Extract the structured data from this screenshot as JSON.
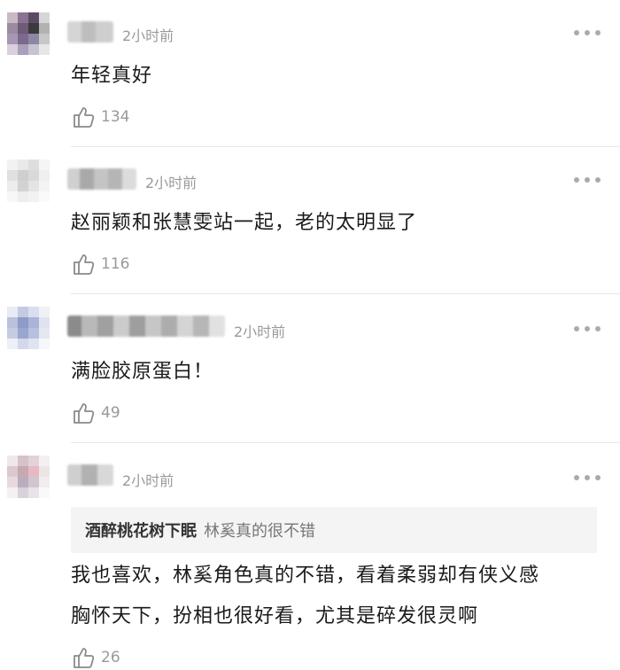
{
  "comments": [
    {
      "time": "2小时前",
      "text": "年轻真好",
      "likes": "134"
    },
    {
      "time": "2小时前",
      "text": "赵丽颖和张慧雯站一起，老的太明显了",
      "likes": "116"
    },
    {
      "time": "2小时前",
      "text": "满脸胶原蛋白！",
      "likes": "49"
    },
    {
      "time": "2小时前",
      "quote": {
        "user": "酒醉桃花树下眠",
        "text": "林奚真的很不错"
      },
      "text_lines": [
        "我也喜欢，林奚角色真的不错，看着柔弱却有侠义感",
        "胸怀天下，扮相也很好看，尤其是碎发很灵啊"
      ],
      "likes": "26"
    }
  ],
  "icons": {
    "like": "thumbs-up-icon",
    "more": "more-dots-icon",
    "avatar": "pixelated-avatar"
  },
  "colors": {
    "time": "#9a9a9a",
    "divider": "#e8e8e8",
    "quote_bg": "#f4f4f4"
  }
}
